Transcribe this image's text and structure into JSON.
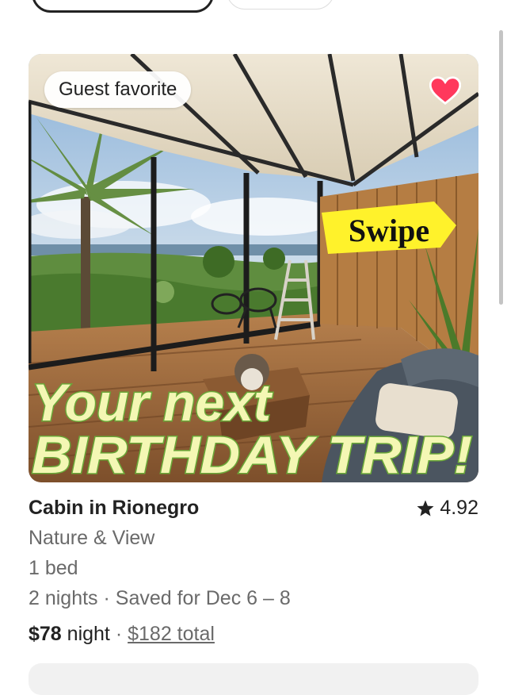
{
  "listing": {
    "badge": "Guest favorite",
    "overlay_swipe": "Swipe",
    "overlay_line1": "Your next",
    "overlay_line2": "BIRTHDAY TRIP!",
    "title": "Cabin in Rionegro",
    "rating": "4.92",
    "subtitle": "Nature & View",
    "beds": "1 bed",
    "dates": "2 nights · Saved for Dec 6 – 8",
    "price_amount": "$78",
    "price_unit": " night",
    "price_sep": " · ",
    "price_total": "$182 total",
    "saved": true
  },
  "colors": {
    "heart": "#ff385c",
    "overlay_text": "#f4f7b4",
    "overlay_outline": "#6aa838",
    "swipe_bg": "#fff22b"
  },
  "icons": {
    "saved": "heart-icon",
    "rating": "star-icon"
  }
}
